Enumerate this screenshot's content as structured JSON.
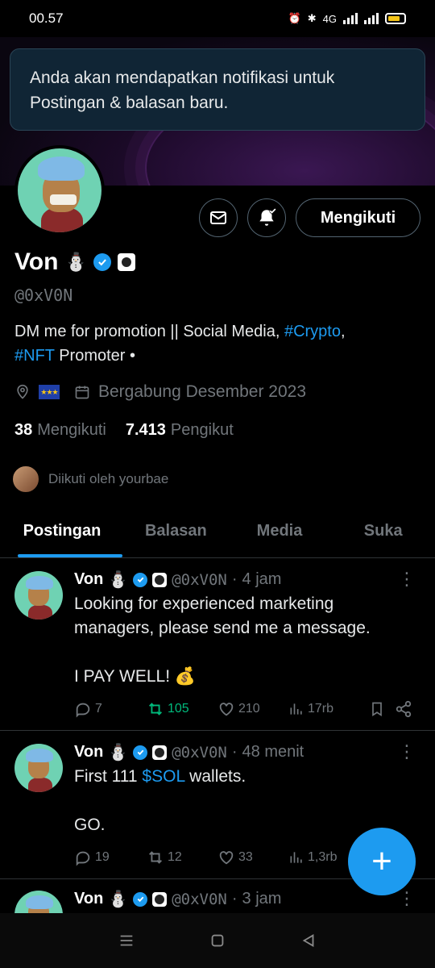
{
  "status_bar": {
    "time": "00.57",
    "network": "4G"
  },
  "toast": {
    "text": "Anda akan mendapatkan notifikasi untuk Postingan & balasan baru."
  },
  "actions": {
    "follow_label": "Mengikuti"
  },
  "profile": {
    "name": "Von",
    "name_emoji": "⛄",
    "handle": "@0xV0N",
    "bio_part1": "DM me for promotion || Social Media, ",
    "bio_link1": "#Crypto",
    "bio_part2": ",",
    "bio_link2": "#NFT",
    "bio_part3": " Promoter •",
    "joined": "Bergabung Desember 2023",
    "following_count": "38",
    "following_label": "Mengikuti",
    "followers_count": "7.413",
    "followers_label": "Pengikut",
    "followed_by": "Diikuti oleh yourbae"
  },
  "tabs": [
    {
      "label": "Postingan",
      "active": true
    },
    {
      "label": "Balasan"
    },
    {
      "label": "Media"
    },
    {
      "label": "Suka"
    }
  ],
  "posts": [
    {
      "name": "Von",
      "emoji": "⛄",
      "handle": "@0xV0N",
      "dot": "·",
      "time": "4 jam",
      "text": "Looking for experienced marketing managers, please send me a message.\n\nI PAY WELL! 💰",
      "replies": "7",
      "reposts": "105",
      "likes": "210",
      "views": "17rb"
    },
    {
      "name": "Von",
      "emoji": "⛄",
      "handle": "@0xV0N",
      "dot": "·",
      "time": "48 menit",
      "text_pre": "First 111 ",
      "text_link": "$SOL",
      "text_post": " wallets.\n\nGO.",
      "replies": "19",
      "reposts": "12",
      "likes": "33",
      "views": "1,3rb"
    },
    {
      "name": "Von",
      "emoji": "⛄",
      "handle": "@0xV0N",
      "dot": "·",
      "time": "3 jam"
    }
  ],
  "fab": {
    "label": "+"
  },
  "colors": {
    "accent": "#1d9bf0",
    "repost_green": "#00ba7c",
    "muted": "#71767b",
    "background": "#000000"
  }
}
